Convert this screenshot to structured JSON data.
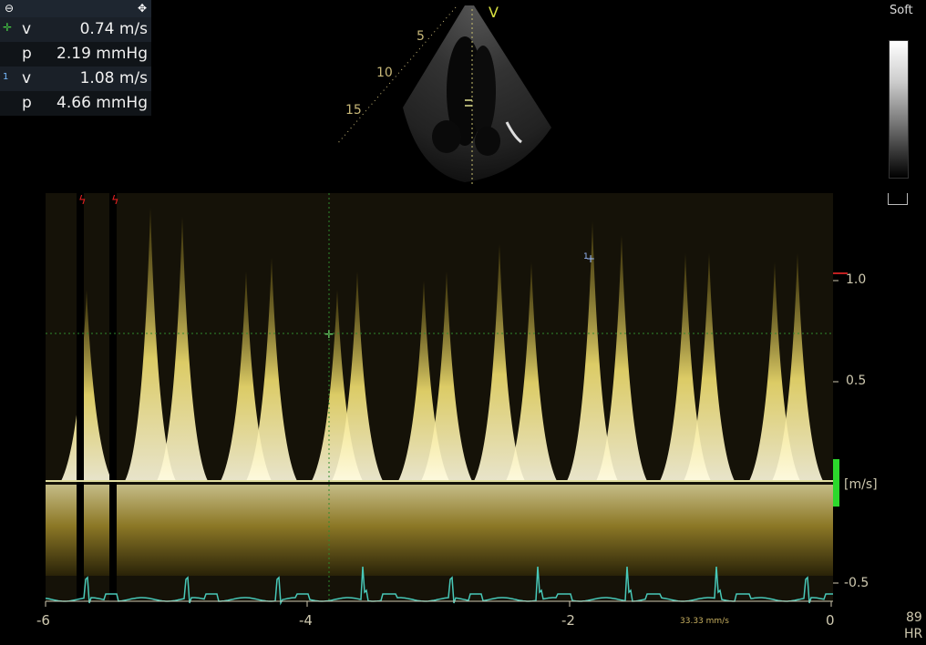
{
  "measurements": {
    "toolbar": {
      "collapse_icon": "circle-minus-icon",
      "move_icon": "move-arrows-icon"
    },
    "rows": [
      {
        "marker": "green-plus-marker",
        "label": "v",
        "value": "0.74 m/s"
      },
      {
        "marker": "",
        "label": "p",
        "value": "2.19 mmHg"
      },
      {
        "marker": "1",
        "label": "v",
        "value": "1.08 m/s"
      },
      {
        "marker": "",
        "label": "p",
        "value": "4.66 mmHg"
      }
    ]
  },
  "image2d": {
    "orientation_mark": "V",
    "depth_labels": [
      "5",
      "10",
      "15"
    ]
  },
  "grayscale": {
    "label": "Soft"
  },
  "doppler": {
    "y_ticks": [
      "1.0",
      "0.5",
      "-0.5"
    ],
    "unit": "[m/s]",
    "x_ticks": [
      "-6",
      "-4",
      "-2",
      "0"
    ],
    "sweep_speed": "33.33 mm/s",
    "cursor_labels": {
      "measure1": "1"
    },
    "colors": {
      "spectrum": "#f4e060",
      "ecg": "#48c8b8",
      "baseline": "#e0dca0",
      "cursor": "#2e8a2e"
    }
  },
  "hr": {
    "value": "89",
    "label": "HR"
  }
}
